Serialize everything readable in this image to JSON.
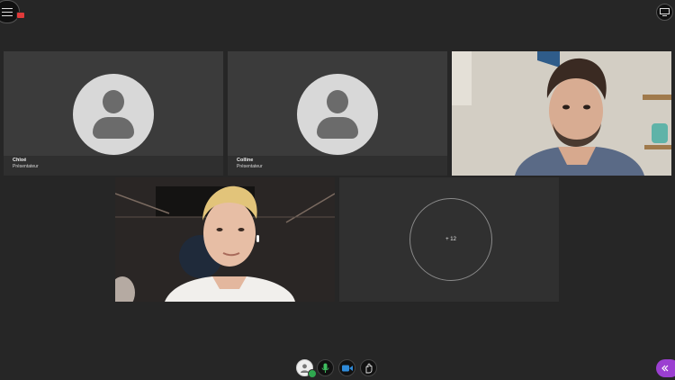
{
  "participants": [
    {
      "name": "Chloé",
      "role": "Présentateur"
    },
    {
      "name": "Colline",
      "role": "Présentateur"
    }
  ],
  "overflow": {
    "label": "+ 12"
  },
  "icons": {
    "menu": "hamburger-menu-icon",
    "menu_badge": "notification-badge",
    "view": "grid-view-icon",
    "user": "user-avatar-icon",
    "mic": "microphone-icon",
    "camera": "video-camera-icon",
    "hand": "raise-hand-icon",
    "collab": "collapse-panel-icon"
  },
  "colors": {
    "background": "#262626",
    "tile": "#3b3b3b",
    "accent_green": "#2fa84f",
    "mic_green": "#3fbf5f",
    "camera_blue": "#2e8ad8",
    "panel_purple": "#9b3fd1"
  }
}
